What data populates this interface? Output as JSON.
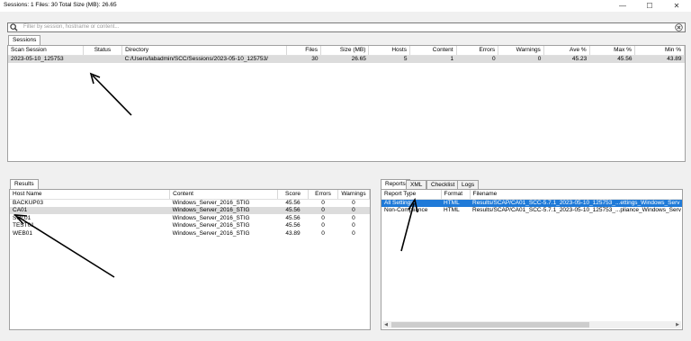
{
  "window": {
    "title": "Sessions: 1   Files: 30   Total Size (MB): 26.65",
    "controls": {
      "minimize": "—",
      "maximize": "☐",
      "close": "✕"
    }
  },
  "search": {
    "placeholder": "Filter by session, hostname or content...",
    "icon": "search-icon"
  },
  "sessions": {
    "tab": "Sessions",
    "columns": [
      "Scan Session",
      "Status",
      "Directory",
      "Files",
      "Size (MB)",
      "Hosts",
      "Content",
      "Errors",
      "Warnings",
      "Ave %",
      "Max %",
      "Min %"
    ],
    "rows": [
      [
        "2023-05-10_125753",
        "",
        "C:/Users/labadmin/SCC/Sessions/2023-05-10_125753/",
        "30",
        "26.65",
        "5",
        "1",
        "0",
        "0",
        "45.23",
        "45.56",
        "43.89"
      ]
    ]
  },
  "results": {
    "tab": "Results",
    "columns": [
      "Host Name",
      "Content",
      "Score",
      "Errors",
      "Warnings"
    ],
    "rows": [
      [
        "BACKUP03",
        "Windows_Server_2016_STIG",
        "45.56",
        "0",
        "0"
      ],
      [
        "CA01",
        "Windows_Server_2016_STIG",
        "45.56",
        "0",
        "0"
      ],
      [
        "SQL01",
        "Windows_Server_2016_STIG",
        "45.56",
        "0",
        "0"
      ],
      [
        "TEST01",
        "Windows_Server_2016_STIG",
        "45.56",
        "0",
        "0"
      ],
      [
        "WEB01",
        "Windows_Server_2016_STIG",
        "43.89",
        "0",
        "0"
      ]
    ]
  },
  "reports": {
    "tabs": [
      "Reports",
      "XML",
      "Checklist",
      "Logs"
    ],
    "columns": [
      "Report Type",
      "Format",
      "Filename"
    ],
    "rows": [
      [
        "All Settings",
        "HTML",
        "Results/SCAP/CA01_SCC-5.7.1_2023-05-10_125753_...ettings_Windows_Serv"
      ],
      [
        "Non-Compliance",
        "HTML",
        "Results/SCAP/CA01_SCC-5.7.1_2023-05-10_125753_...pliance_Windows_Serv"
      ]
    ]
  },
  "colors": {
    "selection": "#1f7ad8",
    "row_highlight": "#dcdcdc",
    "arrow": "#000000"
  }
}
